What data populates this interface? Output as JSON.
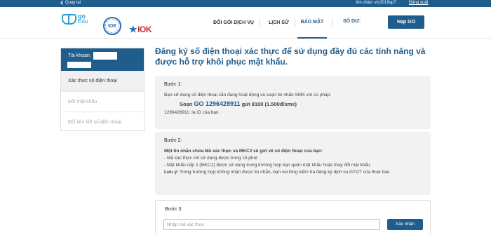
{
  "topbar": {
    "back_icon": "chevron-left-icon",
    "back_label": "Quay lại",
    "greeting": "Xin chào: vtc2019op7",
    "logout_label": "Đăng xuất"
  },
  "header": {
    "logo_go": "go",
    "logo_edu": "Edu",
    "logo_ioe": "IOE",
    "logo_iok": "IOK",
    "nav": [
      "ĐỔI GÓI DỊCH VỤ",
      "LỊCH SỬ",
      "BẢO MẬT"
    ],
    "active_nav": "BẢO MẬT",
    "balance_label": "SỐ DƯ:",
    "topup_label": "Nạp GO"
  },
  "sidebar": {
    "account_label": "Tài khoản:",
    "items": [
      "Xác thực số điện thoại",
      "Đổi mật khẩu",
      "Đổi liên kết số điện thoại"
    ]
  },
  "main": {
    "title": "Đăng ký số điện thoại xác thực để sử dụng đầy đủ các tính năng và được hỗ trợ khôi phục mật khẩu.",
    "step1": {
      "label": "Bước 1:",
      "intro": "Bạn sử dụng số điện thoại vẫn đang hoạt động và soạn tin nhắn SMS với cú pháp:",
      "sms_prefix": "Soạn",
      "sms_code": "GO 1296428911",
      "sms_suffix": "gửi 8100 (1.500đ/sms)",
      "id_note": "1296428911: là ID của bạn"
    },
    "step2": {
      "label": "Bước 2:",
      "heading": "Một tin nhắn chứa Mã xác thực và MKC2 sẽ gửi về số điện thoại của bạn:",
      "line1": "- Mã xác thực chỉ sử dụng được trong 15 phút",
      "line2": "- Mật khẩu cấp 2 (MKC2) được sử dụng trong trường hợp bạn quên mật khẩu hoặc thay đổi mật khẩu",
      "note_label": "Lưu ý:",
      "note_text": "Trong trường hợp không nhận được tin nhắn, bạn vui lòng kiểm tra đăng ký dịch vụ GTGT của thuê bao"
    },
    "step3": {
      "label": "Bước 3:",
      "input_placeholder": "Nhập mã xác thực",
      "submit_label": "Xác nhận"
    }
  }
}
